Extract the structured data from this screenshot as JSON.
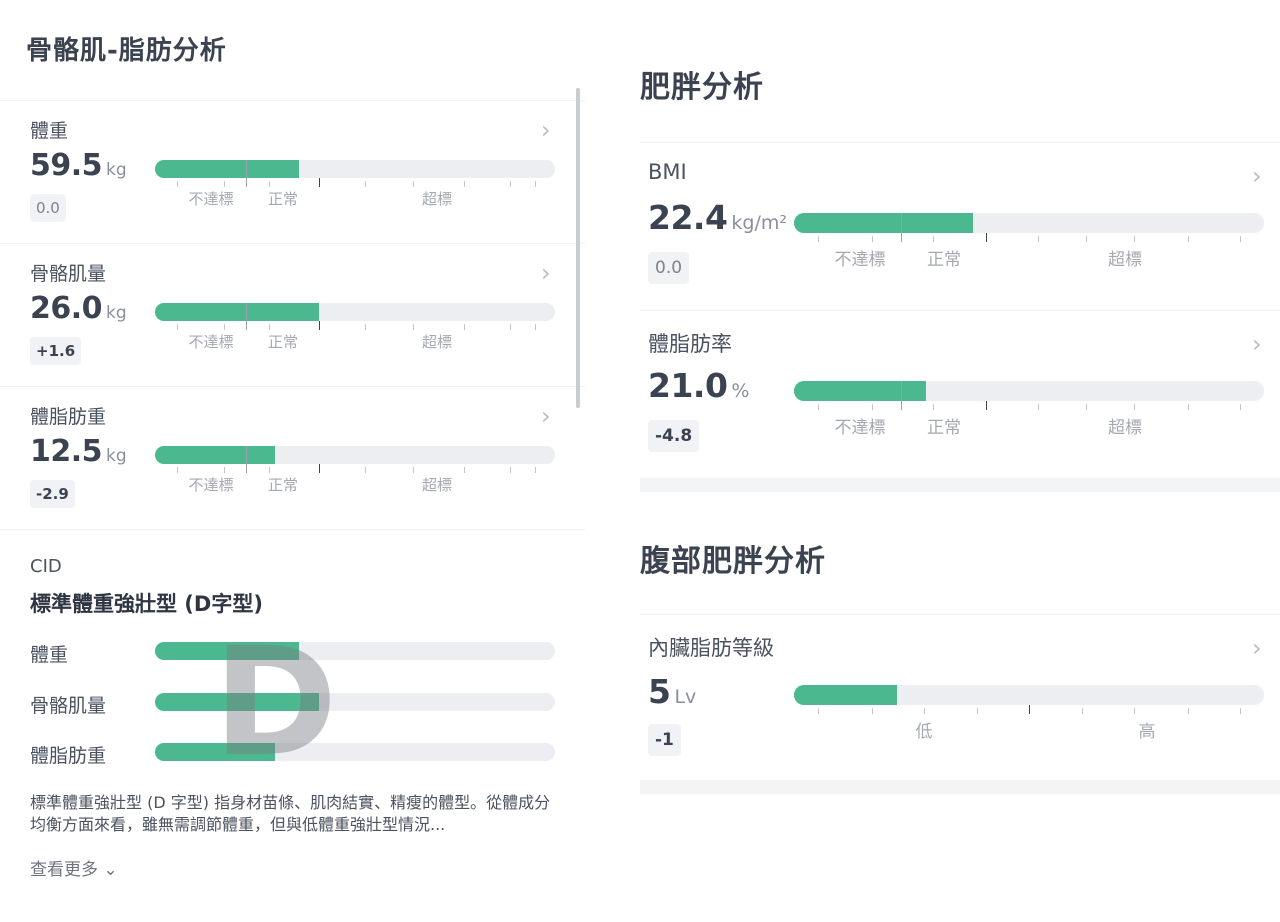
{
  "left": {
    "title": "骨骼肌-脂肪分析",
    "metrics": [
      {
        "label": "體重",
        "value": "59.5",
        "unit": "kg",
        "delta": "0.0",
        "fill": 0.36
      },
      {
        "label": "骨骼肌量",
        "value": "26.0",
        "unit": "kg",
        "delta": "+1.6",
        "fill": 0.41
      },
      {
        "label": "體脂肪重",
        "value": "12.5",
        "unit": "kg",
        "delta": "-2.9",
        "fill": 0.3
      }
    ],
    "zones": {
      "low": "不達標",
      "normal": "正常",
      "high": "超標"
    },
    "cid": {
      "label": "CID",
      "type": "標準體重強壯型 (D字型)",
      "letter": "D",
      "rows": [
        {
          "label": "體重",
          "fill": 0.36
        },
        {
          "label": "骨骼肌量",
          "fill": 0.41
        },
        {
          "label": "體脂肪重",
          "fill": 0.3
        }
      ],
      "description": "標準體重強壯型 (D 字型) 指身材苗條、肌肉結實、精瘦的體型。從體成分均衡方面來看，雖無需調節體重，但與低體重強壯型情況...",
      "see_more": "查看更多 ⌄"
    }
  },
  "right": {
    "obesity_title": "肥胖分析",
    "metrics": [
      {
        "label": "BMI",
        "value": "22.4",
        "unit": "kg/m²",
        "delta": "0.0",
        "fill": 0.38
      },
      {
        "label": "體脂肪率",
        "value": "21.0",
        "unit": "%",
        "delta": "-4.8",
        "fill": 0.28
      }
    ],
    "zones": {
      "low": "不達標",
      "normal": "正常",
      "high": "超標"
    },
    "abdominal_title": "腹部肥胖分析",
    "visceral": {
      "label": "內臟脂肪等級",
      "value": "5",
      "unit": "Lv",
      "delta": "-1",
      "fill": 0.22,
      "low": "低",
      "high": "高"
    }
  },
  "colors": {
    "fill": "#4cb88f",
    "track": "#eceef1"
  },
  "icons": {
    "chevron": "chevron-right-icon"
  }
}
